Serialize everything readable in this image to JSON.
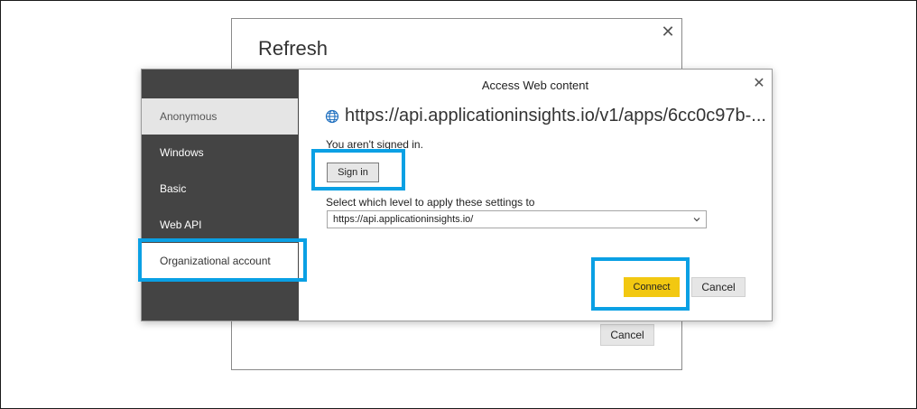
{
  "refresh_dialog": {
    "title": "Refresh",
    "close_icon": "close-icon",
    "cancel_label": "Cancel"
  },
  "access_dialog": {
    "title": "Access Web content",
    "close_icon": "close-icon",
    "sidebar": {
      "items": [
        {
          "label": "Anonymous",
          "selected": true
        },
        {
          "label": "Windows",
          "selected": false
        },
        {
          "label": "Basic",
          "selected": false
        },
        {
          "label": "Web API",
          "selected": false
        },
        {
          "label": "Organizational account",
          "selected": false,
          "highlighted": true
        }
      ]
    },
    "url": "https://api.applicationinsights.io/v1/apps/6cc0c97b-...",
    "url_icon": "globe-icon",
    "signed_status": "You aren't signed in.",
    "sign_in_label": "Sign in",
    "level_label": "Select which level to apply these settings to",
    "level_value": "https://api.applicationinsights.io/",
    "connect_label": "Connect",
    "cancel_label": "Cancel"
  },
  "colors": {
    "sidebar_bg": "#444444",
    "connect_yellow": "#f2c811",
    "highlight_blue": "#0aa0e4",
    "globe_blue": "#1e6fbf"
  }
}
